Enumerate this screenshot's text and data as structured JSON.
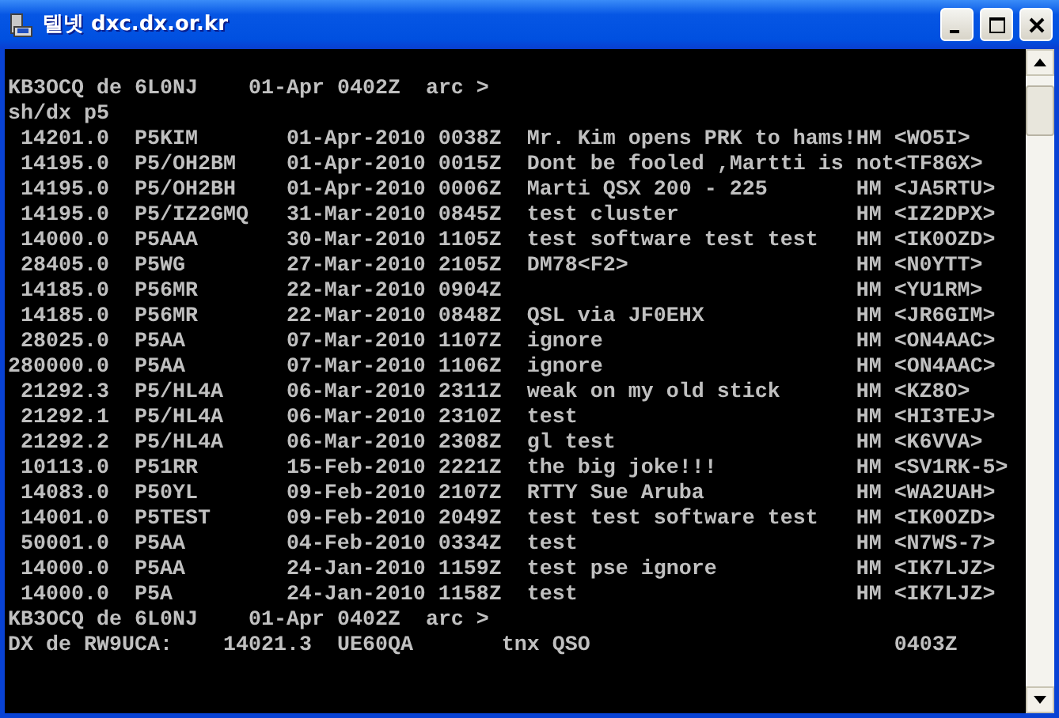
{
  "window": {
    "title": "텔넷 dxc.dx.or.kr",
    "buttons": [
      {
        "kind": "minimize"
      },
      {
        "kind": "maximize"
      },
      {
        "kind": "close"
      }
    ]
  },
  "terminal": {
    "lines_before": [
      "KB3OCQ de 6L0NJ    01-Apr 0402Z  arc >",
      "sh/dx p5"
    ],
    "spots": [
      {
        "freq": "14201.0",
        "call": "P5KIM",
        "date": "01-Apr-2010",
        "time": "0038Z",
        "comment": "Mr. Kim opens PRK to hams!",
        "flag": "HM",
        "spotter": "<WO5I>"
      },
      {
        "freq": "14195.0",
        "call": "P5/OH2BM",
        "date": "01-Apr-2010",
        "time": "0015Z",
        "comment": "Dont be fooled ,Martti is not",
        "spotter": "<TF8GX>"
      },
      {
        "freq": "14195.0",
        "call": "P5/OH2BH",
        "date": "01-Apr-2010",
        "time": "0006Z",
        "comment": "Marti QSX 200 - 225",
        "flag": "HM",
        "spotter": "<JA5RTU>"
      },
      {
        "freq": "14195.0",
        "call": "P5/IZ2GMQ",
        "date": "31-Mar-2010",
        "time": "0845Z",
        "comment": "test cluster",
        "flag": "HM",
        "spotter": "<IZ2DPX>"
      },
      {
        "freq": "14000.0",
        "call": "P5AAA",
        "date": "30-Mar-2010",
        "time": "1105Z",
        "comment": "test software test test",
        "flag": "HM",
        "spotter": "<IK0OZD>"
      },
      {
        "freq": "28405.0",
        "call": "P5WG",
        "date": "27-Mar-2010",
        "time": "2105Z",
        "comment": "DM78<F2>",
        "flag": "HM",
        "spotter": "<N0YTT>"
      },
      {
        "freq": "14185.0",
        "call": "P56MR",
        "date": "22-Mar-2010",
        "time": "0904Z",
        "flag": "HM",
        "spotter": "<YU1RM>"
      },
      {
        "freq": "14185.0",
        "call": "P56MR",
        "date": "22-Mar-2010",
        "time": "0848Z",
        "comment": "QSL via JF0EHX",
        "flag": "HM",
        "spotter": "<JR6GIM>"
      },
      {
        "freq": "28025.0",
        "call": "P5AA",
        "date": "07-Mar-2010",
        "time": "1107Z",
        "comment": "ignore",
        "flag": "HM",
        "spotter": "<ON4AAC>"
      },
      {
        "freq": "280000.0",
        "call": "P5AA",
        "date": "07-Mar-2010",
        "time": "1106Z",
        "comment": "ignore",
        "flag": "HM",
        "spotter": "<ON4AAC>"
      },
      {
        "freq": "21292.3",
        "call": "P5/HL4A",
        "date": "06-Mar-2010",
        "time": "2311Z",
        "comment": "weak on my old stick",
        "flag": "HM",
        "spotter": "<KZ8O>"
      },
      {
        "freq": "21292.1",
        "call": "P5/HL4A",
        "date": "06-Mar-2010",
        "time": "2310Z",
        "comment": "test",
        "flag": "HM",
        "spotter": "<HI3TEJ>"
      },
      {
        "freq": "21292.2",
        "call": "P5/HL4A",
        "date": "06-Mar-2010",
        "time": "2308Z",
        "comment": "gl test",
        "flag": "HM",
        "spotter": "<K6VVA>"
      },
      {
        "freq": "10113.0",
        "call": "P51RR",
        "date": "15-Feb-2010",
        "time": "2221Z",
        "comment": "the big joke!!!",
        "flag": "HM",
        "spotter": "<SV1RK-5>"
      },
      {
        "freq": "14083.0",
        "call": "P50YL",
        "date": "09-Feb-2010",
        "time": "2107Z",
        "comment": "RTTY Sue Aruba",
        "flag": "HM",
        "spotter": "<WA2UAH>"
      },
      {
        "freq": "14001.0",
        "call": "P5TEST",
        "date": "09-Feb-2010",
        "time": "2049Z",
        "comment": "test test software test",
        "flag": "HM",
        "spotter": "<IK0OZD>"
      },
      {
        "freq": "50001.0",
        "call": "P5AA",
        "date": "04-Feb-2010",
        "time": "0334Z",
        "comment": "test",
        "flag": "HM",
        "spotter": "<N7WS-7>"
      },
      {
        "freq": "14000.0",
        "call": "P5AA",
        "date": "24-Jan-2010",
        "time": "1159Z",
        "comment": "test pse ignore",
        "flag": "HM",
        "spotter": "<IK7LJZ>"
      },
      {
        "freq": "14000.0",
        "call": "P5A",
        "date": "24-Jan-2010",
        "time": "1158Z",
        "comment": "test",
        "flag": "HM",
        "spotter": "<IK7LJZ>"
      }
    ],
    "lines_after": [
      "KB3OCQ de 6L0NJ    01-Apr 0402Z  arc >",
      "DX de RW9UCA:    14021.3  UE60QA       tnx QSO                        0403Z"
    ]
  }
}
